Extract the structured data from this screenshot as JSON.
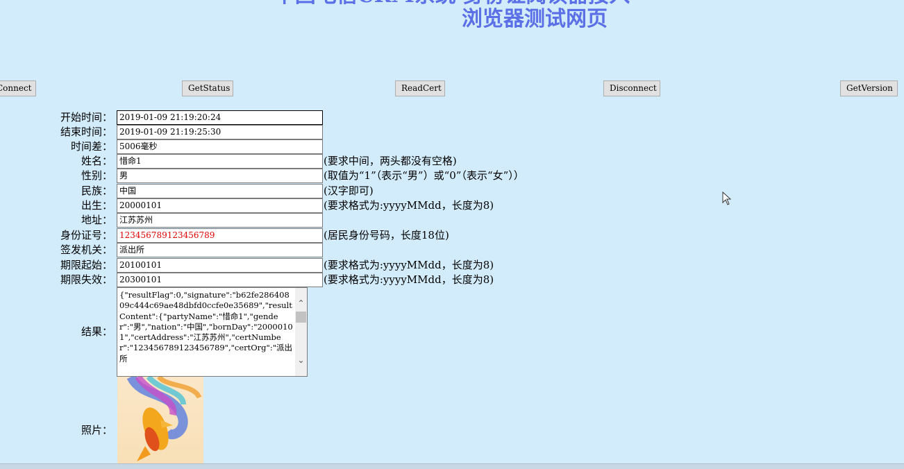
{
  "header": {
    "title_line1": "中国电信CRM系统 身份证阅读器接入",
    "title_line2": "浏览器测试网页"
  },
  "toolbar": {
    "buttons": [
      "Connect",
      "GetStatus",
      "ReadCert",
      "Disconnect",
      "GetVersion"
    ]
  },
  "form": {
    "start_time": {
      "label": "开始时间：",
      "value": "2019-01-09 21:19:20:24"
    },
    "end_time": {
      "label": "结束时间：",
      "value": "2019-01-09 21:19:25:30"
    },
    "time_diff": {
      "label": "时间差：",
      "value": "5006毫秒"
    },
    "name": {
      "label": "姓名：",
      "value": "惜命1",
      "hint": "(要求中间，两头都没有空格)"
    },
    "gender": {
      "label": "性别：",
      "value": "男",
      "hint": "(取值为“1”（表示“男”）或“0”（表示“女”））"
    },
    "nation": {
      "label": "民族：",
      "value": "中国",
      "hint": "(汉字即可)"
    },
    "birth": {
      "label": "出生：",
      "value": "20000101",
      "hint": "(要求格式为:yyyyMMdd，长度为8)"
    },
    "address": {
      "label": "地址：",
      "value": "江苏苏州"
    },
    "id_number": {
      "label": "身份证号：",
      "value": "123456789123456789",
      "hint": "(居民身份号码，长度18位)"
    },
    "issuer": {
      "label": "签发机关：",
      "value": "派出所"
    },
    "valid_from": {
      "label": "期限起始：",
      "value": "20100101",
      "hint": "(要求格式为:yyyyMMdd，长度为8)"
    },
    "valid_to": {
      "label": "期限失效：",
      "value": "20300101",
      "hint": "(要求格式为:yyyyMMdd，长度为8)"
    },
    "result": {
      "label": "结果：",
      "value": "{\"resultFlag\":0,\"signature\":\"b62fe28640809c444c69ae48dbfd0ccfe0e35689\",\"resultContent\":{\"partyName\":\"惜命1\",\"gender\":\"男\",\"nation\":\"中国\",\"bornDay\":\"20000101\",\"certAddress\":\"江苏苏州\",\"certNumber\":\"123456789123456789\",\"certOrg\":\"派出所"
    },
    "photo": {
      "label": "照片："
    }
  },
  "colors": {
    "background": "#d2ecfb",
    "title": "#5b6fe6",
    "id_number_text": "#e00000"
  }
}
